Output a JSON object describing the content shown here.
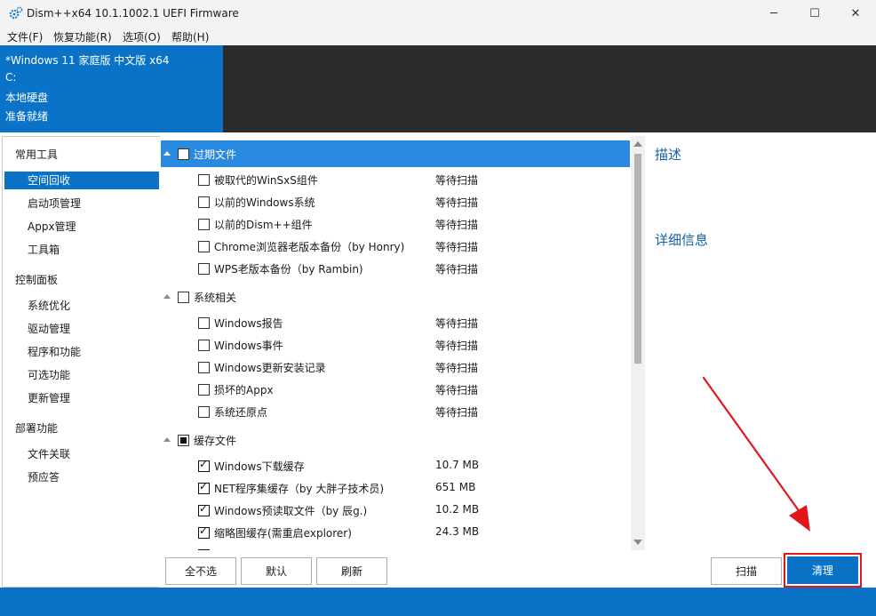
{
  "window": {
    "title": "Dism++x64 10.1.1002.1 UEFI Firmware",
    "minimize_glyph": "─",
    "maximize_glyph": "☐",
    "close_glyph": "✕"
  },
  "menu": [
    {
      "label": "文件(F)"
    },
    {
      "label": "恢复功能(R)"
    },
    {
      "label": "选项(O)"
    },
    {
      "label": "帮助(H)"
    }
  ],
  "header": {
    "system_name": "*Windows 11 家庭版 中文版 x64",
    "drive": "C:",
    "disk_type": "本地硬盘",
    "status": "准备就绪"
  },
  "nav": {
    "sections": [
      {
        "title": "常用工具",
        "items": [
          "空间回收",
          "启动项管理",
          "Appx管理",
          "工具箱"
        ]
      },
      {
        "title": "控制面板",
        "items": [
          "系统优化",
          "驱动管理",
          "程序和功能",
          "可选功能",
          "更新管理"
        ]
      },
      {
        "title": "部署功能",
        "items": [
          "文件关联",
          "预应答"
        ]
      }
    ],
    "selected": "空间回收"
  },
  "cleanup": {
    "groups": [
      {
        "label": "过期文件",
        "state": "unchecked",
        "items": [
          {
            "label": "被取代的WinSxS组件",
            "status": "等待扫描",
            "checked": false
          },
          {
            "label": "以前的Windows系统",
            "status": "等待扫描",
            "checked": false
          },
          {
            "label": "以前的Dism++组件",
            "status": "等待扫描",
            "checked": false
          },
          {
            "label": "Chrome浏览器老版本备份（by Honry)",
            "status": "等待扫描",
            "checked": false
          },
          {
            "label": "WPS老版本备份（by Rambin)",
            "status": "等待扫描",
            "checked": false
          }
        ]
      },
      {
        "label": "系统相关",
        "state": "unchecked",
        "items": [
          {
            "label": "Windows报告",
            "status": "等待扫描",
            "checked": false
          },
          {
            "label": "Windows事件",
            "status": "等待扫描",
            "checked": false
          },
          {
            "label": "Windows更新安装记录",
            "status": "等待扫描",
            "checked": false
          },
          {
            "label": "损坏的Appx",
            "status": "等待扫描",
            "checked": false
          },
          {
            "label": "系统还原点",
            "status": "等待扫描",
            "checked": false
          }
        ]
      },
      {
        "label": "缓存文件",
        "state": "partial",
        "items": [
          {
            "label": "Windows下载缓存",
            "status": "10.7 MB",
            "checked": true
          },
          {
            "label": "NET程序集缓存（by 大胖子技术员)",
            "status": "651 MB",
            "checked": true
          },
          {
            "label": "Windows预读取文件（by 辰g.)",
            "status": "10.2 MB",
            "checked": true
          },
          {
            "label": "缩略图缓存(需重启explorer)",
            "status": "24.3 MB",
            "checked": true
          }
        ]
      }
    ]
  },
  "right_pane": {
    "description_title": "描述",
    "details_title": "详细信息"
  },
  "buttons": {
    "deselect_all": "全不选",
    "default": "默认",
    "refresh": "刷新",
    "scan": "扫描",
    "clean": "清理"
  },
  "colors": {
    "accent": "#0a73c8",
    "selected_group": "#2a8ae2",
    "annotation": "#e3161c",
    "header_dark": "#2b2b2b",
    "section_title": "#1560a8"
  }
}
